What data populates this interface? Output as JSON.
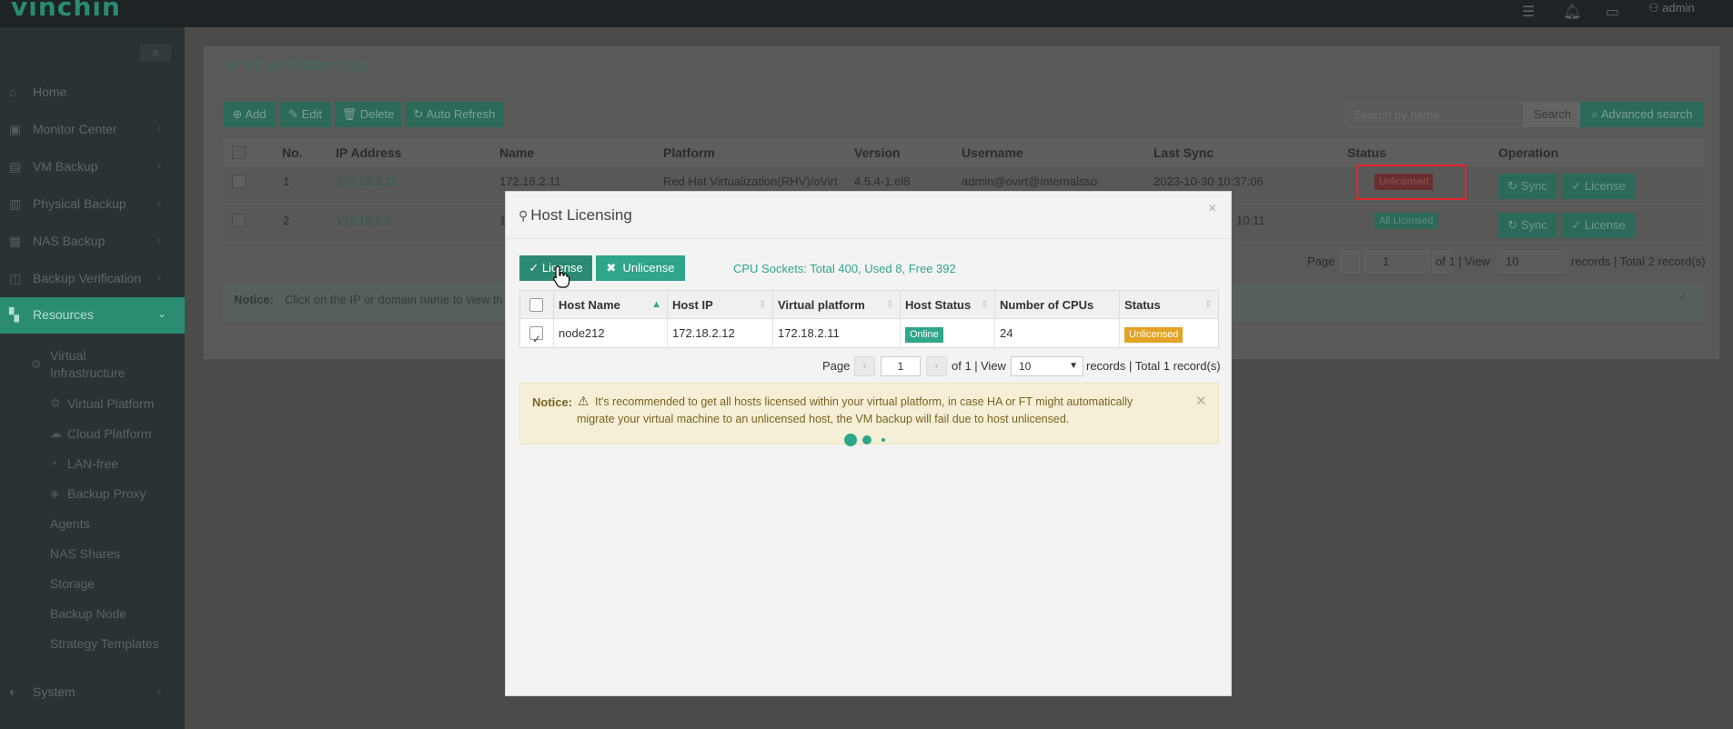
{
  "app": {
    "logo": "vinchin",
    "user": "admin"
  },
  "sidebar": {
    "items": [
      {
        "label": "Home",
        "icon": "home-icon"
      },
      {
        "label": "Monitor Center",
        "icon": "monitor-icon"
      },
      {
        "label": "VM Backup",
        "icon": "vm-icon"
      },
      {
        "label": "Physical Backup",
        "icon": "physical-icon"
      },
      {
        "label": "NAS Backup",
        "icon": "nas-icon"
      },
      {
        "label": "Backup Verification",
        "icon": "verify-icon"
      },
      {
        "label": "Resources",
        "icon": "resources-icon"
      },
      {
        "label": "System",
        "icon": "system-icon"
      }
    ],
    "sub_group": "Virtual Infrastructure",
    "sub_group_line1": "Virtual",
    "sub_group_line2": "Infrastructure",
    "sub_items": [
      "Virtual Platform",
      "Cloud Platform",
      "LAN-free",
      "Backup Proxy"
    ],
    "resource_items": [
      "Agents",
      "NAS Shares",
      "Storage",
      "Backup Node",
      "Strategy Templates"
    ]
  },
  "page": {
    "title": "Virtual Platform List",
    "toolbar": {
      "add": "Add",
      "edit": "Edit",
      "delete": "Delete",
      "auto_refresh": "Auto Refresh"
    },
    "search": {
      "placeholder": "Search by name",
      "button": "Search",
      "advanced": "Advanced search"
    },
    "table": {
      "headers": [
        "No.",
        "IP Address",
        "Name",
        "Platform",
        "Version",
        "Username",
        "Last Sync",
        "Status",
        "Operation"
      ],
      "rows": [
        {
          "no": "1",
          "ip": "172.18.2.11",
          "name": "172.18.2.11",
          "platform": "Red Hat Virtualization(RHV)/oVirt",
          "version": "4.5.4-1.el8",
          "username": "admin@ovirt@internalsso",
          "last_sync": "2023-10-30 10:37:06",
          "status": "Unlicensed"
        },
        {
          "no": "2",
          "ip": "172.18.2.1",
          "name": "1",
          "last_sync": "10:11",
          "status": "All Licensed"
        }
      ],
      "op_sync": "Sync",
      "op_license": "License"
    },
    "pager": {
      "page_label": "Page",
      "page_value": "1",
      "of_label": "of 1 |",
      "view_label": "View",
      "view_value": "10",
      "records_text": "records | Total 2 record(s)"
    },
    "notice": {
      "label": "Notice:",
      "text": "Click on the IP or domain name to view th"
    }
  },
  "modal": {
    "title": "Host Licensing",
    "license_button": "License",
    "unlicense_button": "Unlicense",
    "cpu_info": "CPU Sockets: Total 400, Used 8, Free 392",
    "table": {
      "headers": [
        "Host Name",
        "Host IP",
        "Virtual platform",
        "Host Status",
        "Number of CPUs",
        "Status"
      ],
      "rows": [
        {
          "host_name": "node212",
          "host_ip": "172.18.2.12",
          "virtual_platform": "172.18.2.11",
          "host_status": "Online",
          "cpus": "24",
          "status": "Unlicensed"
        }
      ]
    },
    "pager": {
      "page_label": "Page",
      "page_value": "1",
      "of_label": "of 1 |",
      "view_label": "View",
      "view_value": "10",
      "records_text": "records | Total 1 record(s)"
    },
    "notice": {
      "label": "Notice:",
      "line1": "It's recommended to get all hosts licensed within your virtual platform, in case HA or FT might automatically",
      "line2": "migrate your virtual machine to an unlicensed host, the VM backup will fail due to host unlicensed."
    }
  },
  "colors": {
    "brand": "#2fa58a",
    "highlight": "#e8232a",
    "warning": "#e2a325"
  }
}
